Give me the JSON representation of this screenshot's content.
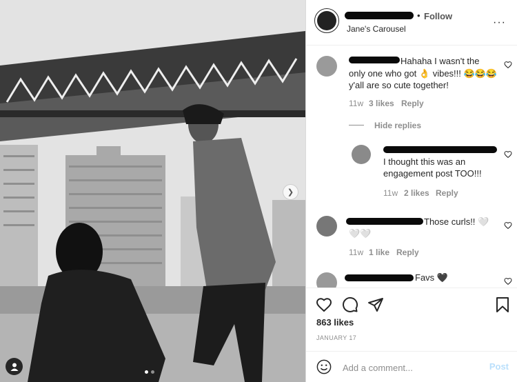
{
  "header": {
    "follow_dot": "•",
    "follow_label": "Follow",
    "location": "Jane's Carousel",
    "more_label": "···"
  },
  "comments": [
    {
      "text_line1": "Hahaha I wasn't the",
      "text_line2": "only one who got 👌 vibes!!! 😂😂😂",
      "text_line3": "y'all are so cute together!",
      "age": "11w",
      "likes": "3 likes",
      "reply": "Reply"
    },
    {
      "hide_replies": "Hide replies"
    },
    {
      "text_line1": "I thought this was an",
      "text_line2": "engagement post TOO!!!",
      "age": "11w",
      "likes": "2 likes",
      "reply": "Reply"
    },
    {
      "text_line1": "Those curls!! 🤍",
      "text_line2": "🤍🤍",
      "age": "11w",
      "likes": "1 like",
      "reply": "Reply"
    },
    {
      "text_line1": "Favs 🖤"
    }
  ],
  "actions": {
    "likes": "863 likes",
    "date": "JANUARY 17"
  },
  "add_comment": {
    "placeholder": "Add a comment...",
    "post_label": "Post"
  },
  "icons": {
    "like": "heart-icon",
    "comment": "comment-icon",
    "share": "share-icon",
    "save": "bookmark-icon",
    "emoji": "emoji-icon",
    "next": "chevron-right-icon",
    "tag": "user-tag-icon"
  }
}
